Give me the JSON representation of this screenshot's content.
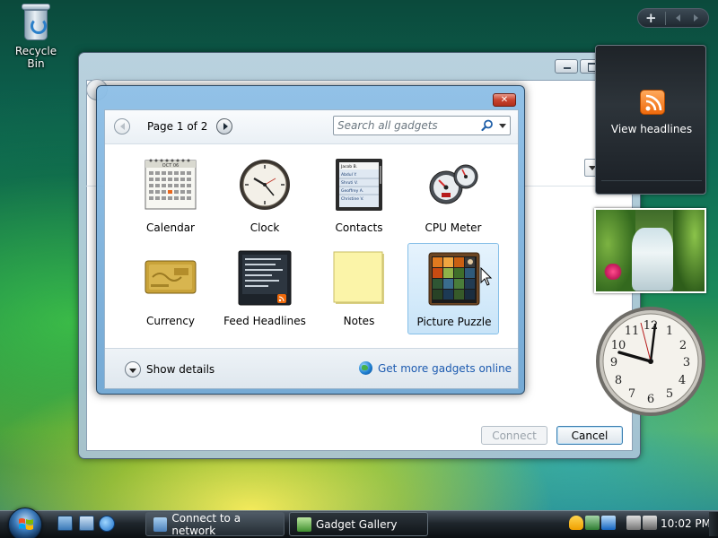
{
  "desktop": {
    "recycle_bin_label": "Recycle Bin"
  },
  "back_window": {
    "connect_label": "Connect",
    "cancel_label": "Cancel"
  },
  "gallery": {
    "page_label": "Page 1 of 2",
    "search_placeholder": "Search all gadgets",
    "gadgets": [
      {
        "name": "Calendar",
        "icon": "calendar-icon"
      },
      {
        "name": "Clock",
        "icon": "clock-icon"
      },
      {
        "name": "Contacts",
        "icon": "contacts-icon"
      },
      {
        "name": "CPU Meter",
        "icon": "cpu-meter-icon"
      },
      {
        "name": "Currency",
        "icon": "currency-icon"
      },
      {
        "name": "Feed Headlines",
        "icon": "feed-headlines-icon"
      },
      {
        "name": "Notes",
        "icon": "notes-icon"
      },
      {
        "name": "Picture Puzzle",
        "icon": "picture-puzzle-icon",
        "selected": true
      }
    ],
    "calendar_month": "OCT 06",
    "contacts_names": [
      "Jacob B.",
      "Abdul Y.",
      "Shruti V.",
      "Geoffrey A.",
      "Christine V."
    ],
    "show_details_label": "Show details",
    "more_gadgets_label": "Get more gadgets online"
  },
  "sidebar": {
    "feed_gadget_label": "View headlines"
  },
  "taskbar": {
    "buttons": [
      {
        "label": "Connect to a network",
        "active": false
      },
      {
        "label": "Gadget Gallery",
        "active": true
      }
    ],
    "clock_time": "10:02 PM"
  },
  "colors": {
    "accent_blue": "#1d5bb0",
    "rss_orange": "#ef6a0c",
    "close_red": "#c8432e",
    "selection_bg": "#c8e4f8"
  }
}
